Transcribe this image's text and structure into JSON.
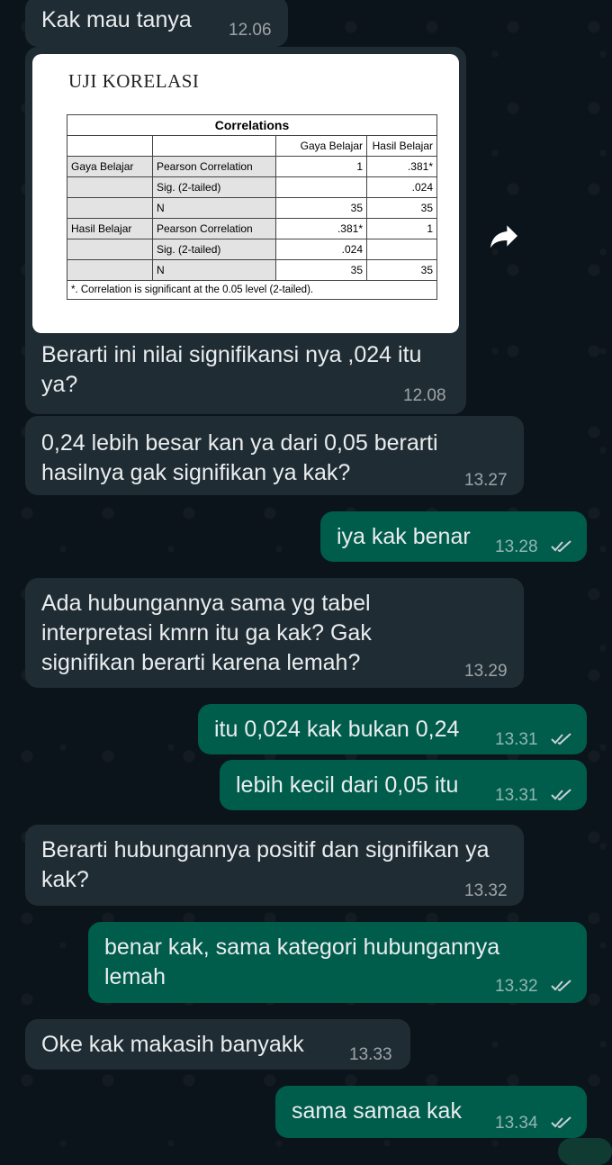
{
  "image_message": {
    "heading": "UJI KORELASI",
    "table": {
      "title": "Correlations",
      "col_headers": [
        "Gaya Belajar",
        "Hasil Belajar"
      ],
      "rows": [
        {
          "group": "Gaya Belajar",
          "stat": "Pearson Correlation",
          "c1": "1",
          "c2": ".381*"
        },
        {
          "group": "",
          "stat": "Sig. (2-tailed)",
          "c1": "",
          "c2": ".024"
        },
        {
          "group": "",
          "stat": "N",
          "c1": "35",
          "c2": "35"
        },
        {
          "group": "Hasil Belajar",
          "stat": "Pearson Correlation",
          "c1": ".381*",
          "c2": "1"
        },
        {
          "group": "",
          "stat": "Sig. (2-tailed)",
          "c1": ".024",
          "c2": ""
        },
        {
          "group": "",
          "stat": "N",
          "c1": "35",
          "c2": "35"
        }
      ],
      "footnote": "*. Correlation is significant at the 0.05 level (2-tailed)."
    },
    "caption": "Berarti ini nilai signifikansi nya ,024 itu ya?",
    "time": "12.08"
  },
  "messages": [
    {
      "id": "m0",
      "dir": "in",
      "text": "Kak mau tanya",
      "time": "12.06"
    },
    {
      "id": "m1",
      "dir": "in",
      "text": "0,24 lebih besar kan ya dari 0,05 berarti hasilnya gak signifikan ya kak?",
      "time": "13.27"
    },
    {
      "id": "m2",
      "dir": "out",
      "text": "iya kak benar",
      "time": "13.28"
    },
    {
      "id": "m3",
      "dir": "in",
      "text": "Ada hubungannya sama yg tabel interpretasi kmrn itu ga kak? Gak signifikan berarti karena lemah?",
      "time": "13.29"
    },
    {
      "id": "m4",
      "dir": "out",
      "text": "itu 0,024 kak bukan 0,24",
      "time": "13.31"
    },
    {
      "id": "m5",
      "dir": "out",
      "text": "lebih kecil dari 0,05 itu",
      "time": "13.31"
    },
    {
      "id": "m6",
      "dir": "in",
      "text": "Berarti hubungannya positif dan signifikan ya kak?",
      "time": "13.32"
    },
    {
      "id": "m7",
      "dir": "out",
      "text": "benar kak, sama kategori hubungannya lemah",
      "time": "13.32"
    },
    {
      "id": "m8",
      "dir": "in",
      "text": "Oke kak makasih banyakk",
      "time": "13.33"
    },
    {
      "id": "m9",
      "dir": "out",
      "text": "sama samaa kak",
      "time": "13.34"
    }
  ],
  "icons": {
    "forward": "forward-arrow-icon",
    "read_receipt": "double-check-icon"
  },
  "colors": {
    "background": "#0b141a",
    "incoming_bubble": "#202c33",
    "outgoing_bubble": "#005c4b",
    "text": "#e9edef",
    "read_check": "#c9d1d4"
  }
}
